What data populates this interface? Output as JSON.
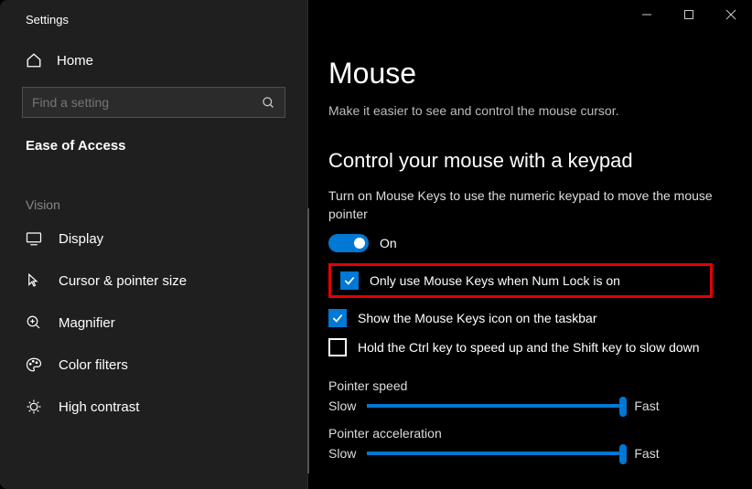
{
  "app_title": "Settings",
  "home_label": "Home",
  "search": {
    "placeholder": "Find a setting"
  },
  "current_section": "Ease of Access",
  "vision_label": "Vision",
  "nav_items": [
    {
      "label": "Display"
    },
    {
      "label": "Cursor & pointer size"
    },
    {
      "label": "Magnifier"
    },
    {
      "label": "Color filters"
    },
    {
      "label": "High contrast"
    }
  ],
  "page": {
    "title": "Mouse",
    "subtitle": "Make it easier to see and control the mouse cursor.",
    "section_heading": "Control your mouse with a keypad",
    "mousekeys_desc": "Turn on Mouse Keys to use the numeric keypad to move the mouse pointer",
    "toggle_state": "On",
    "cb_numlock": "Only use Mouse Keys when Num Lock is on",
    "cb_taskbar": "Show the Mouse Keys icon on the taskbar",
    "cb_ctrl": "Hold the Ctrl key to speed up and the Shift key to slow down",
    "pointer_speed_label": "Pointer speed",
    "pointer_accel_label": "Pointer acceleration",
    "slow": "Slow",
    "fast": "Fast"
  }
}
